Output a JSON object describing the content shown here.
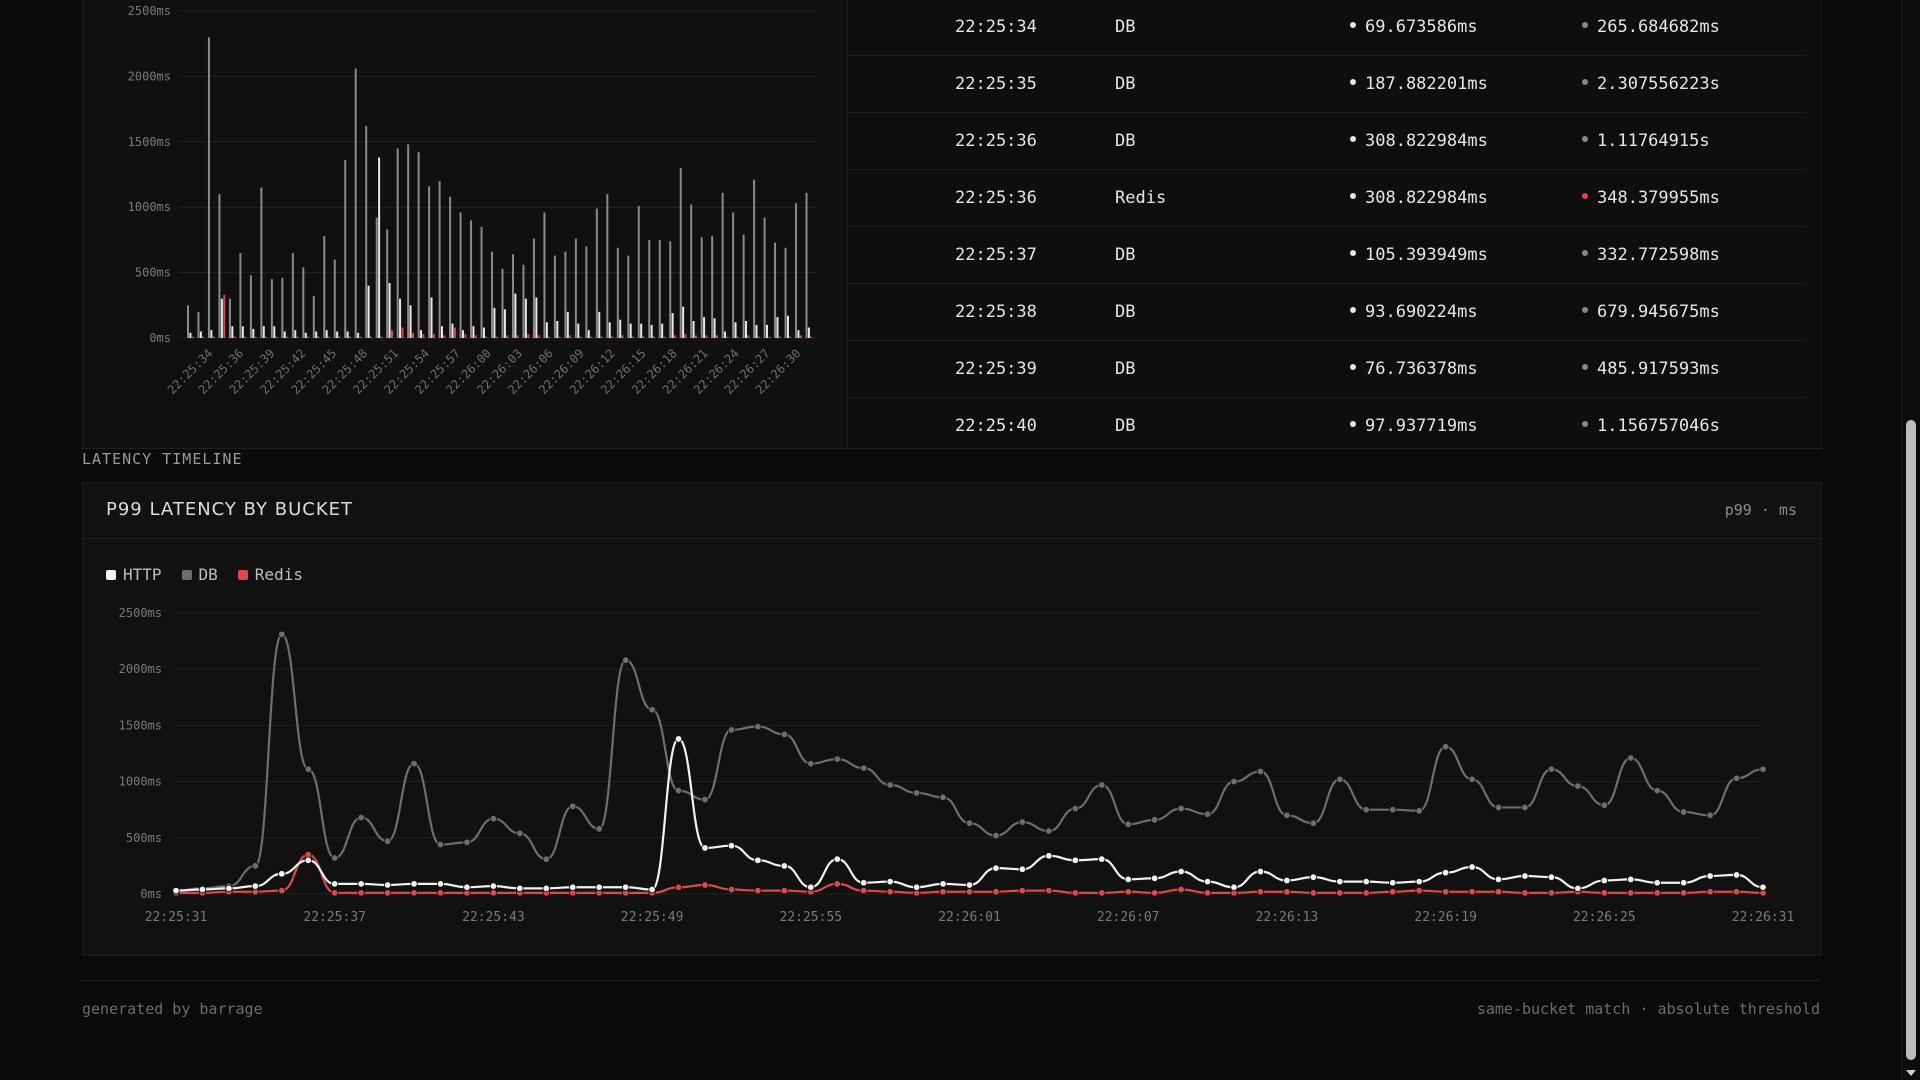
{
  "colors": {
    "http": "#f2f2f2",
    "db": "#6e6e6e",
    "redis": "#e0474c",
    "grid": "#222222"
  },
  "bar_chart": {
    "chart_data": {
      "type": "bar",
      "y_tick_labels": [
        "2500ms",
        "2000ms",
        "1500ms",
        "1000ms",
        "500ms",
        "0ms"
      ],
      "ylim": [
        0,
        2500
      ],
      "x_tick_labels": [
        "22:25:34",
        "22:25:36",
        "22:25:39",
        "22:25:42",
        "22:25:45",
        "22:25:48",
        "22:25:51",
        "22:25:54",
        "22:25:57",
        "22:26:00",
        "22:26:03",
        "22:26:06",
        "22:26:09",
        "22:26:12",
        "22:26:15",
        "22:26:18",
        "22:26:21",
        "22:26:24",
        "22:26:27",
        "22:26:30"
      ],
      "series": [
        {
          "name": "DB",
          "values": [
            250,
            200,
            2300,
            1100,
            300,
            650,
            480,
            1150,
            450,
            460,
            650,
            540,
            320,
            780,
            600,
            1360,
            2060,
            1620,
            920,
            830,
            1450,
            1480,
            1420,
            1160,
            1200,
            1080,
            960,
            900,
            850,
            660,
            530,
            640,
            560,
            760,
            960,
            630,
            660,
            760,
            700,
            990,
            1100,
            690,
            630,
            1010,
            750,
            750,
            740,
            1300,
            1020,
            770,
            780,
            1110,
            960,
            790,
            1210,
            920,
            730,
            690,
            1030,
            1110
          ]
        },
        {
          "name": "HTTP",
          "values": [
            40,
            50,
            60,
            300,
            90,
            90,
            70,
            90,
            90,
            50,
            60,
            40,
            50,
            60,
            50,
            50,
            40,
            400,
            1380,
            420,
            300,
            250,
            60,
            310,
            90,
            110,
            60,
            90,
            80,
            230,
            220,
            340,
            300,
            310,
            120,
            130,
            200,
            110,
            60,
            200,
            120,
            140,
            110,
            110,
            100,
            110,
            190,
            240,
            130,
            160,
            150,
            50,
            120,
            130,
            100,
            100,
            160,
            170,
            60,
            80
          ]
        },
        {
          "name": "Redis",
          "values": [
            10,
            10,
            10,
            330,
            10,
            10,
            10,
            10,
            10,
            10,
            10,
            10,
            10,
            10,
            10,
            10,
            10,
            10,
            10,
            60,
            80,
            40,
            30,
            30,
            20,
            80,
            30,
            20,
            10,
            10,
            20,
            20,
            30,
            20,
            10,
            10,
            20,
            10,
            10,
            10,
            10,
            20,
            10,
            10,
            10,
            10,
            20,
            30,
            20,
            20,
            20,
            10,
            10,
            20,
            10,
            10,
            10,
            10,
            20,
            10
          ]
        }
      ]
    }
  },
  "table": {
    "rows": [
      {
        "time": "22:25:34",
        "service": "DB",
        "a": "69.673586ms",
        "b": "265.684682ms",
        "badge": "DB (masked)",
        "b_red": false,
        "badge_kind": "db"
      },
      {
        "time": "22:25:35",
        "service": "DB",
        "a": "187.882201ms",
        "b": "2.307556223s",
        "badge": "DB",
        "b_red": false,
        "badge_kind": "db"
      },
      {
        "time": "22:25:36",
        "service": "DB",
        "a": "308.822984ms",
        "b": "1.11764915s",
        "badge": "DB",
        "b_red": false,
        "badge_kind": "db"
      },
      {
        "time": "22:25:36",
        "service": "Redis",
        "a": "308.822984ms",
        "b": "348.379955ms",
        "badge": "Redis",
        "b_red": true,
        "badge_kind": "redis"
      },
      {
        "time": "22:25:37",
        "service": "DB",
        "a": "105.393949ms",
        "b": "332.772598ms",
        "badge": "DB",
        "b_red": false,
        "badge_kind": "db"
      },
      {
        "time": "22:25:38",
        "service": "DB",
        "a": "93.690224ms",
        "b": "679.945675ms",
        "badge": "DB (masked)",
        "b_red": false,
        "badge_kind": "db"
      },
      {
        "time": "22:25:39",
        "service": "DB",
        "a": "76.736378ms",
        "b": "485.917593ms",
        "badge": "DB (masked)",
        "b_red": false,
        "badge_kind": "db"
      },
      {
        "time": "22:25:40",
        "service": "DB",
        "a": "97.937719ms",
        "b": "1.156757046s",
        "badge": "DB (masked)",
        "b_red": false,
        "badge_kind": "db"
      }
    ]
  },
  "section_label": "LATENCY TIMELINE",
  "card": {
    "title": "P99 LATENCY BY BUCKET",
    "unit": "p99 · ms",
    "legend": [
      {
        "name": "HTTP",
        "color": "#f2f2f2"
      },
      {
        "name": "DB",
        "color": "#6e6e6e"
      },
      {
        "name": "Redis",
        "color": "#e0474c"
      }
    ]
  },
  "chart_data": {
    "type": "line",
    "ylim": [
      0,
      2500
    ],
    "y_tick_labels": [
      "2500ms",
      "2000ms",
      "1500ms",
      "1000ms",
      "500ms",
      "0ms"
    ],
    "x_tick_labels": [
      "22:25:31",
      "22:25:37",
      "22:25:43",
      "22:25:49",
      "22:25:55",
      "22:26:01",
      "22:26:07",
      "22:26:13",
      "22:26:19",
      "22:26:25",
      "22:26:31"
    ],
    "series": [
      {
        "name": "HTTP",
        "values": [
          30,
          40,
          50,
          70,
          180,
          300,
          90,
          90,
          80,
          90,
          90,
          60,
          70,
          50,
          50,
          60,
          60,
          60,
          40,
          1380,
          410,
          430,
          300,
          250,
          60,
          310,
          100,
          110,
          60,
          90,
          80,
          230,
          220,
          340,
          300,
          310,
          130,
          140,
          200,
          110,
          60,
          200,
          120,
          150,
          110,
          110,
          100,
          110,
          190,
          240,
          130,
          160,
          150,
          50,
          120,
          130,
          100,
          100,
          160,
          170,
          60
        ]
      },
      {
        "name": "DB",
        "values": [
          30,
          50,
          70,
          250,
          2310,
          1110,
          320,
          680,
          470,
          1160,
          440,
          460,
          670,
          540,
          310,
          780,
          580,
          2080,
          1640,
          920,
          840,
          1460,
          1490,
          1420,
          1160,
          1200,
          1120,
          970,
          900,
          860,
          630,
          520,
          640,
          560,
          760,
          970,
          620,
          660,
          760,
          710,
          1000,
          1090,
          700,
          630,
          1020,
          750,
          750,
          740,
          1310,
          1020,
          770,
          770,
          1110,
          960,
          790,
          1210,
          920,
          730,
          700,
          1030,
          1110
        ]
      },
      {
        "name": "Redis",
        "values": [
          10,
          10,
          20,
          20,
          30,
          350,
          10,
          10,
          10,
          10,
          10,
          10,
          10,
          10,
          10,
          10,
          10,
          10,
          10,
          60,
          80,
          40,
          30,
          30,
          20,
          90,
          30,
          20,
          10,
          20,
          20,
          20,
          30,
          30,
          10,
          10,
          20,
          10,
          40,
          10,
          10,
          20,
          20,
          10,
          10,
          10,
          20,
          30,
          20,
          20,
          20,
          10,
          10,
          20,
          10,
          10,
          10,
          10,
          20,
          20,
          10
        ]
      }
    ]
  },
  "footer": {
    "left": "generated by barrage",
    "right": "same-bucket match · absolute threshold"
  }
}
